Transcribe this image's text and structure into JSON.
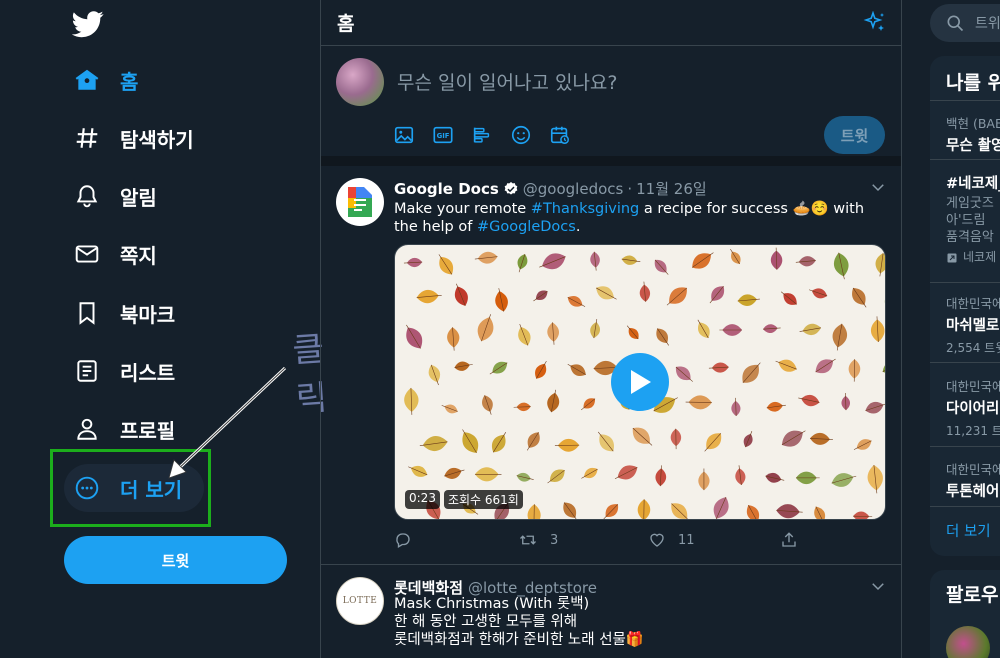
{
  "sidebar": {
    "nav": [
      {
        "label": "홈",
        "icon": "home-icon",
        "active": true
      },
      {
        "label": "탐색하기",
        "icon": "hashtag-icon"
      },
      {
        "label": "알림",
        "icon": "bell-icon"
      },
      {
        "label": "쪽지",
        "icon": "mail-icon"
      },
      {
        "label": "북마크",
        "icon": "bookmark-icon"
      },
      {
        "label": "리스트",
        "icon": "list-icon"
      },
      {
        "label": "프로필",
        "icon": "profile-icon"
      },
      {
        "label": "더 보기",
        "icon": "more-icon"
      }
    ],
    "tweet_button": "트윗",
    "annotation": "클릭"
  },
  "main": {
    "title": "홈",
    "composer": {
      "placeholder": "무슨 일이 일어나고 있나요?",
      "tweet_button": "트윗",
      "tools": [
        "image-icon",
        "gif-icon",
        "poll-icon",
        "emoji-icon",
        "schedule-icon"
      ]
    },
    "tweets": [
      {
        "name": "Google Docs",
        "handle": "@googledocs",
        "separator": "·",
        "date": "11월 26일",
        "text_before": "Make your remote ",
        "hashtag1": "#Thanksgiving",
        "text_mid": " a recipe for success 🥧☺️  with the help of ",
        "hashtag2": "#GoogleDocs",
        "text_after": ".",
        "video_time": "0:23",
        "video_views": "조회수 661회",
        "retweets": "3",
        "likes": "11"
      },
      {
        "name": "롯데백화점",
        "handle": "@lotte_deptstore",
        "avatar_text": "LOTTE",
        "lines": [
          "Mask Christmas (With 롯백)",
          "한 해 동안 고생한 모두를 위해",
          "롯데백화점과 한해가 준비한 노래 선물🎁"
        ]
      }
    ]
  },
  "right": {
    "search_placeholder": "트위",
    "trends_title": "나를 위",
    "trends": [
      {
        "cat": "백현 (BAE",
        "name": "무슨 촬영"
      },
      {
        "cat": "",
        "name": "#네코제_",
        "sub1": "게임굿즈",
        "sub2": "아'드림 ",
        "sub3": "품격음악",
        "promo": "네코제"
      },
      {
        "cat": "대한민국에",
        "name": "마쉬멜로",
        "sub1": "2,554 트윗"
      },
      {
        "cat": "대한민국에",
        "name": "다이어리",
        "sub1": "11,231 트"
      },
      {
        "cat": "대한민국에",
        "name": "투톤헤어"
      }
    ],
    "more_label": "더 보기",
    "follow_title": "팔로우"
  },
  "colors": {
    "background": "#15202b",
    "accent": "#1da1f2",
    "highlight_box": "#1cae1c"
  }
}
